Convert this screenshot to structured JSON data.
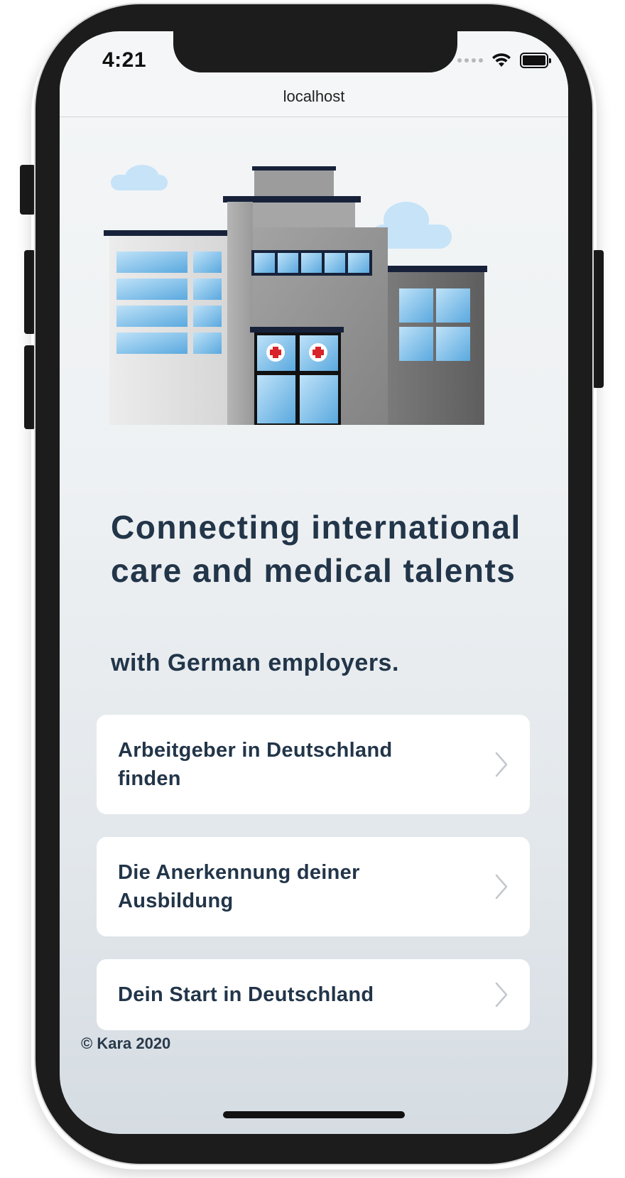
{
  "status_bar": {
    "time": "4:21",
    "signal_icon": "signal-dots-icon",
    "wifi_icon": "wifi-icon",
    "battery_icon": "battery-icon"
  },
  "browser": {
    "url": "localhost"
  },
  "hero": {
    "illustration_icon": "hospital-building-illustration",
    "headline": "Connecting international care and medical talents",
    "subheadline": "with German employers."
  },
  "nav_items": [
    {
      "label": "Arbeitgeber in Deutschland finden",
      "icon": "chevron-right-icon"
    },
    {
      "label": "Die Anerkennung deiner Ausbildung",
      "icon": "chevron-right-icon"
    },
    {
      "label": "Dein Start in Deutschland",
      "icon": "chevron-right-icon"
    }
  ],
  "footer": {
    "copyright": "© Kara 2020"
  },
  "colors": {
    "text_primary": "#223549",
    "card_background": "#ffffff",
    "screen_top": "#f4f6f7",
    "screen_bottom": "#d5dce2"
  }
}
